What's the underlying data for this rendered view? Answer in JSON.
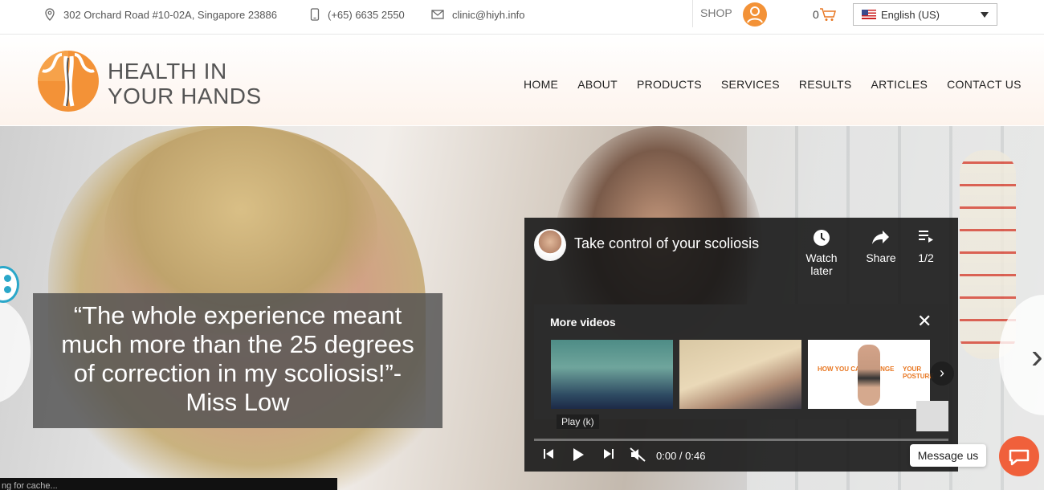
{
  "topbar": {
    "address": "302 Orchard Road #10-02A, Singapore 23886",
    "phone": "(+65) 6635 2550",
    "email": "clinic@hiyh.info",
    "shop_label": "SHOP",
    "cart_count": "0",
    "language": "English (US)"
  },
  "header": {
    "logo_line1": "HEALTH IN",
    "logo_line2": "YOUR HANDS",
    "nav": [
      "HOME",
      "ABOUT",
      "PRODUCTS",
      "SERVICES",
      "RESULTS",
      "ARTICLES",
      "CONTACT US"
    ]
  },
  "hero": {
    "quote_line1": "“The whole experience meant",
    "quote_line2": "much more than the 25 degrees",
    "quote_line3": "of correction in my scoliosis!”-",
    "quote_line4": "Miss Low",
    "status_text": "ng for cache..."
  },
  "video": {
    "title": "Take control of your scoliosis",
    "watch_later": "Watch later",
    "share": "Share",
    "playlist": "1/2",
    "more_videos": "More videos",
    "thumb3_left": "HOW YOU CAN CHANGE",
    "thumb3_right": "YOUR POSTURE",
    "play_tooltip": "Play (k)",
    "time": "0:00 / 0:46"
  },
  "chat": {
    "label": "Message us"
  },
  "colors": {
    "brand_orange": "#f39237",
    "chat_red": "#f0603b"
  }
}
